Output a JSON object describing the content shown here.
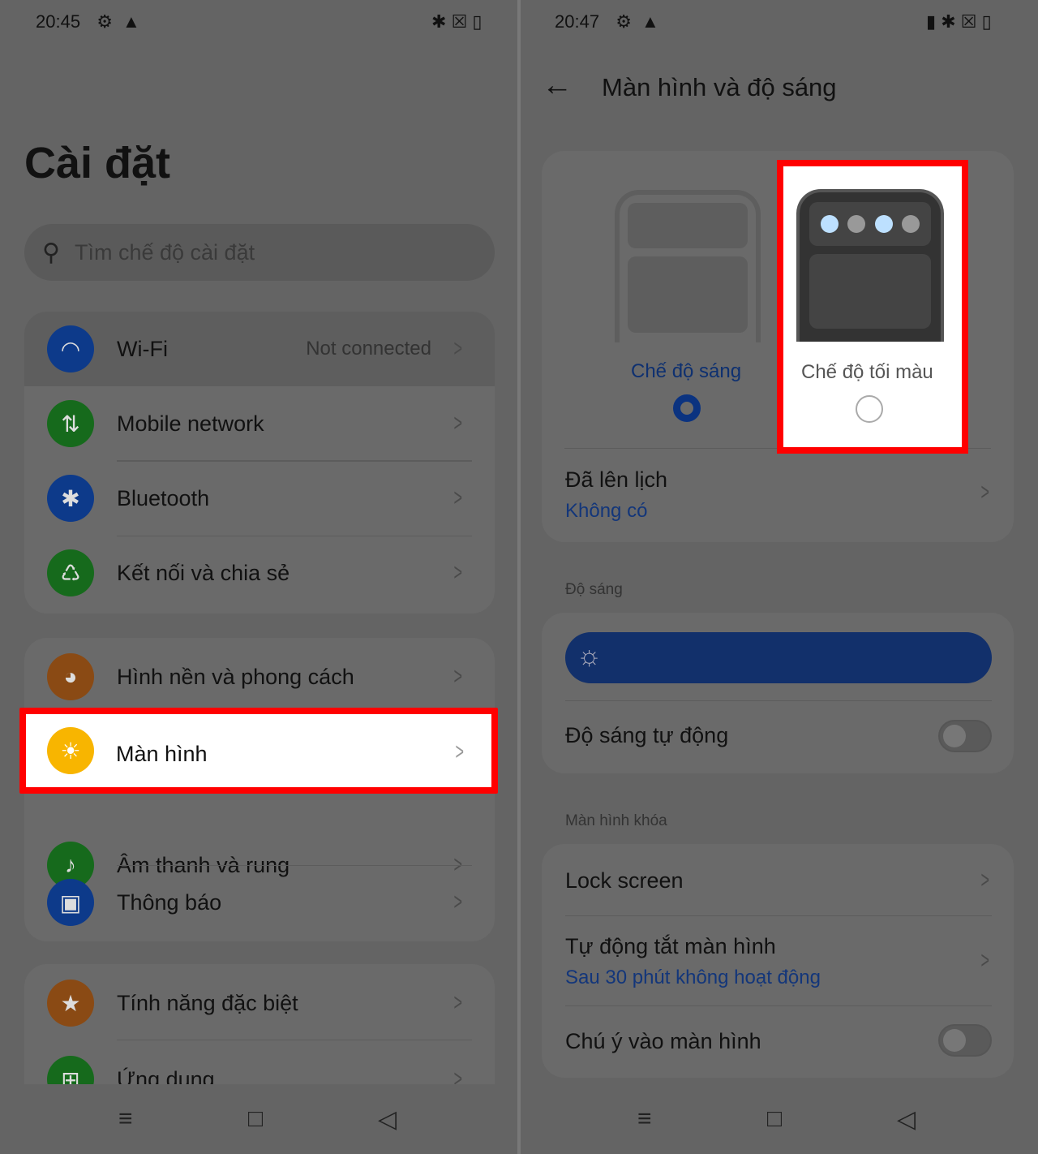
{
  "left": {
    "status": {
      "time": "20:45"
    },
    "title": "Cài đặt",
    "search": {
      "placeholder": "Tìm chế độ cài đặt"
    },
    "groups": [
      [
        {
          "label": "Wi-Fi",
          "value": "Not connected",
          "icon": "wifi-icon",
          "color": "#0d3a8a"
        },
        {
          "label": "Mobile network",
          "icon": "mobile-data-icon",
          "color": "#166a1c"
        },
        {
          "label": "Bluetooth",
          "icon": "bluetooth-icon",
          "color": "#0d3a8a"
        },
        {
          "label": "Kết nối và chia sẻ",
          "icon": "share-icon",
          "color": "#166a1c"
        }
      ],
      [
        {
          "label": "Hình nền và phong cách",
          "icon": "palette-icon",
          "color": "#8a4a14"
        },
        {
          "label": "Màn hình",
          "icon": "sun-icon",
          "color": "#f8b500"
        },
        {
          "label": "Âm thanh và rung",
          "icon": "bell-icon",
          "color": "#166a1c"
        },
        {
          "label": "Thông báo",
          "icon": "notification-icon",
          "color": "#0d3a8a"
        }
      ],
      [
        {
          "label": "Tính năng đặc biệt",
          "icon": "star-icon",
          "color": "#8a4a14"
        },
        {
          "label": "Ứng dụng",
          "icon": "apps-icon",
          "color": "#166a1c"
        }
      ]
    ]
  },
  "right": {
    "status": {
      "time": "20:47"
    },
    "title": "Màn hình và độ sáng",
    "modes": [
      {
        "label": "Chế độ sáng",
        "selected": true
      },
      {
        "label": "Chế độ tối màu",
        "selected": false
      }
    ],
    "schedule": {
      "label": "Đã lên lịch",
      "value": "Không có"
    },
    "brightness_section": "Độ sáng",
    "brightness_level": 100,
    "auto_brightness": {
      "label": "Độ sáng tự động",
      "on": false
    },
    "lock_section": "Màn hình khóa",
    "lock_screen": "Lock screen",
    "auto_off": {
      "label": "Tự động tắt màn hình",
      "value": "Sau 30 phút không hoạt động"
    },
    "attention": {
      "label": "Chú ý vào màn hình",
      "on": false
    }
  },
  "highlight_color": "#ff0000"
}
